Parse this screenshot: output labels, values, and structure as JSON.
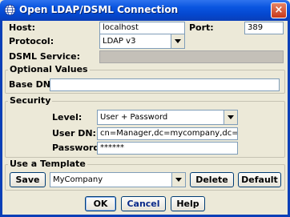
{
  "window": {
    "title": "Open LDAP/DSML Connection",
    "close_label": "×"
  },
  "connection": {
    "host_label": "Host:",
    "host_value": "localhost",
    "port_label": "Port:",
    "port_value": "389",
    "protocol_label": "Protocol:",
    "protocol_value": "LDAP v3",
    "dsml_label": "DSML Service:",
    "dsml_value": ""
  },
  "optional": {
    "title": "Optional Values",
    "base_dn_label": "Base DN:",
    "base_dn_value": ""
  },
  "security": {
    "title": "Security",
    "level_label": "Level:",
    "level_value": "User + Password",
    "user_dn_label": "User DN:",
    "user_dn_value": "cn=Manager,dc=mycompany,dc=com",
    "password_label": "Password:",
    "password_value": "******"
  },
  "template": {
    "title": "Use a Template",
    "save_label": "Save",
    "template_value": "MyCompany",
    "delete_label": "Delete",
    "default_label": "Default"
  },
  "buttons": {
    "ok_label": "OK",
    "cancel_label": "Cancel",
    "help_label": "Help"
  },
  "colors": {
    "titlebar": "#0a55e0",
    "dialog_bg": "#ece9d8",
    "field_border": "#7f9db9"
  },
  "icons": {
    "title": "globe-icon",
    "close": "close-icon",
    "dropdown": "chevron-down-icon"
  }
}
